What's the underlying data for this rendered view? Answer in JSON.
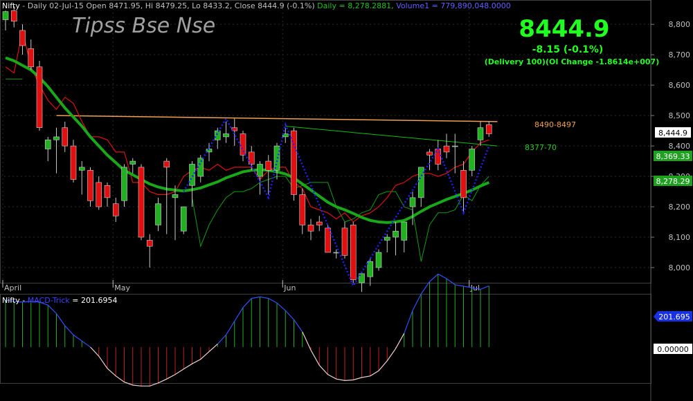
{
  "header": {
    "symbol": "Nifty",
    "info": " - Daily 02-Jul-15 Open 8471.95, Hi 8479.25, Lo 8433.2, Close 8444.9 (-0.1%) ",
    "daily": "Daily = 8,278.2881, ",
    "volume": "Volume1 = 779,890,048.0000"
  },
  "watermark": "Tipss Bse Nse",
  "price_panel": {
    "big_price": "8444.9",
    "change": "-8.15 (-0.1%)",
    "delivery": "(Delivery 100)(OI Change -1.8614e+007)"
  },
  "annotations": {
    "resistance": "8490-8497",
    "support": "8377-70"
  },
  "badges": {
    "last": "8,444.9",
    "ma1": "8,369.33",
    "ma2": "8,278.29",
    "macd": "201.695",
    "zero": "0.00000"
  },
  "indicator": {
    "symbol": "Nifty",
    "name": "MACD-Trick",
    "value": " = 201.6954"
  },
  "chart_data": {
    "type": "candlestick",
    "ylim": [
      7950,
      8880
    ],
    "y_ticks": [
      {
        "v": 8800,
        "label": "8,800"
      },
      {
        "v": 8700,
        "label": "8,700"
      },
      {
        "v": 8600,
        "label": "8,600"
      },
      {
        "v": 8500,
        "label": "8,500"
      },
      {
        "v": 8400,
        "label": "8,400"
      },
      {
        "v": 8300,
        "label": "8,300"
      },
      {
        "v": 8200,
        "label": "8,200"
      },
      {
        "v": 8100,
        "label": "8,100"
      },
      {
        "v": 8000,
        "label": "8,000"
      }
    ],
    "x_labels": [
      {
        "i": 0,
        "label": "April"
      },
      {
        "i": 13,
        "label": "May"
      },
      {
        "i": 33,
        "label": "Jun"
      },
      {
        "i": 55,
        "label": "Jul"
      }
    ],
    "colors": {
      "up": "#20b020",
      "down": "#e01010",
      "ma_thick": "#18a818",
      "ma_red": "#e01010",
      "ma_thin": "#10a010",
      "zigzag": "#2020ff",
      "resistance": "#f0a050",
      "support": "#10c010",
      "price_green": "#20ff20"
    },
    "candles": [
      [
        8815,
        8845,
        8780,
        8842
      ],
      [
        8845,
        8860,
        8790,
        8810
      ],
      [
        8780,
        8800,
        8700,
        8730
      ],
      [
        8720,
        8750,
        8650,
        8660
      ],
      [
        8660,
        8680,
        8450,
        8460
      ],
      [
        8390,
        8430,
        8350,
        8420
      ],
      [
        8420,
        8460,
        8310,
        8430
      ],
      [
        8460,
        8480,
        8380,
        8400
      ],
      [
        8400,
        8420,
        8280,
        8290
      ],
      [
        8320,
        8350,
        8240,
        8330
      ],
      [
        8320,
        8330,
        8200,
        8220
      ],
      [
        8280,
        8300,
        8190,
        8200
      ],
      [
        8270,
        8280,
        8200,
        8230
      ],
      [
        8210,
        8230,
        8150,
        8170
      ],
      [
        8220,
        8340,
        8200,
        8330
      ],
      [
        8340,
        8360,
        8310,
        8350
      ],
      [
        8330,
        8340,
        8090,
        8100
      ],
      [
        8090,
        8110,
        8000,
        8070
      ],
      [
        8140,
        8230,
        8120,
        8210
      ],
      [
        8350,
        8360,
        8110,
        8330
      ],
      [
        8230,
        8270,
        8090,
        8240
      ],
      [
        8120,
        8200,
        8110,
        8200
      ],
      [
        8270,
        8350,
        8200,
        8340
      ],
      [
        8300,
        8370,
        8280,
        8360
      ],
      [
        8380,
        8410,
        8350,
        8390
      ],
      [
        8420,
        8460,
        8390,
        8450
      ],
      [
        8430,
        8480,
        8410,
        8440
      ],
      [
        8460,
        8490,
        8400,
        8450
      ],
      [
        8440,
        8450,
        8350,
        8370
      ],
      [
        8380,
        8400,
        8320,
        8340
      ],
      [
        8300,
        8350,
        8240,
        8340
      ],
      [
        8350,
        8370,
        8240,
        8320
      ],
      [
        8320,
        8410,
        8290,
        8400
      ],
      [
        8430,
        8460,
        8410,
        8440
      ],
      [
        8450,
        8460,
        8220,
        8240
      ],
      [
        8240,
        8260,
        8110,
        8140
      ],
      [
        8140,
        8160,
        8090,
        8120
      ],
      [
        8150,
        8170,
        8120,
        8140
      ],
      [
        8130,
        8140,
        8050,
        8050
      ],
      [
        8050,
        8060,
        8030,
        8050
      ],
      [
        8130,
        8150,
        8030,
        8040
      ],
      [
        8140,
        8150,
        7950,
        7960
      ],
      [
        7950,
        7980,
        7920,
        7980
      ],
      [
        7970,
        8030,
        7940,
        8020
      ],
      [
        8000,
        8060,
        7990,
        8050
      ],
      [
        8090,
        8110,
        8050,
        8100
      ],
      [
        8100,
        8150,
        8040,
        8120
      ],
      [
        8090,
        8150,
        8050,
        8150
      ],
      [
        8200,
        8250,
        8140,
        8230
      ],
      [
        8230,
        8330,
        8200,
        8330
      ],
      [
        8380,
        8390,
        8320,
        8370
      ],
      [
        8390,
        8420,
        8320,
        8340
      ],
      [
        8400,
        8440,
        8360,
        8380
      ],
      [
        8400,
        8440,
        8310,
        8400
      ],
      [
        8320,
        8350,
        8180,
        8230
      ],
      [
        8320,
        8400,
        8300,
        8390
      ],
      [
        8420,
        8480,
        8400,
        8460
      ],
      [
        8470,
        8480,
        8430,
        8440
      ]
    ],
    "ma_thick": [
      8690,
      8680,
      8665,
      8650,
      8625,
      8595,
      8560,
      8525,
      8495,
      8465,
      8430,
      8400,
      8370,
      8345,
      8320,
      8305,
      8290,
      8275,
      8265,
      8258,
      8255,
      8252,
      8256,
      8262,
      8272,
      8282,
      8295,
      8305,
      8315,
      8320,
      8322,
      8320,
      8315,
      8308,
      8295,
      8275,
      8255,
      8235,
      8215,
      8200,
      8190,
      8178,
      8165,
      8155,
      8150,
      8148,
      8150,
      8155,
      8168,
      8185,
      8200,
      8212,
      8224,
      8234,
      8244,
      8255,
      8268,
      8280
    ],
    "ma_red": [
      8660,
      8640,
      8780,
      8660,
      8600,
      8550,
      8520,
      8560,
      8540,
      8480,
      8430,
      8430,
      8420,
      8380,
      8380,
      8280,
      8280,
      8250,
      8240,
      8240,
      8250,
      8300,
      8320,
      8330,
      8320,
      8340,
      8320,
      8330,
      8330,
      8330,
      8290,
      8320,
      8330,
      8330,
      8280,
      8260,
      8200,
      8190,
      8180,
      8160,
      8180,
      8150,
      8170,
      8180,
      8200,
      8230,
      8270,
      8280,
      8300,
      8310,
      8310,
      8300,
      8310,
      8330,
      8340,
      8380,
      8410,
      8420
    ],
    "ma_thin": [
      8620,
      8620,
      8620,
      null,
      null,
      null,
      null,
      null,
      null,
      null,
      null,
      null,
      null,
      null,
      null,
      null,
      null,
      null,
      null,
      null,
      null,
      null,
      8230,
      8070,
      8140,
      8190,
      8230,
      8250,
      8250,
      8260,
      8280,
      8290,
      8300,
      8300,
      8260,
      8270,
      8280,
      8280,
      8280,
      8200,
      8150,
      8160,
      8180,
      8190,
      8240,
      8250,
      8250,
      8200,
      8190,
      8020,
      8140,
      8180,
      8180,
      8190,
      8240,
      8220,
      8270,
      8300
    ],
    "zigzag": [
      [
        21,
        8250
      ],
      [
        26,
        8490
      ],
      [
        31,
        8230
      ],
      [
        33,
        8470
      ],
      [
        41,
        7940
      ],
      [
        51,
        8390
      ],
      [
        54,
        8180
      ],
      [
        57,
        8400
      ]
    ],
    "resistance": [
      [
        6,
        8500
      ],
      [
        58,
        8480
      ]
    ],
    "support": [
      [
        33,
        8465
      ],
      [
        58,
        8400
      ]
    ],
    "macd": [
      155,
      150,
      148,
      150,
      148,
      138,
      110,
      70,
      40,
      20,
      0,
      -30,
      -70,
      -95,
      -115,
      -125,
      -128,
      -128,
      -118,
      -105,
      -90,
      -72,
      -55,
      -40,
      -15,
      10,
      40,
      85,
      130,
      160,
      165,
      160,
      145,
      120,
      90,
      50,
      -10,
      -60,
      -90,
      -105,
      -110,
      -108,
      -100,
      -95,
      -78,
      -45,
      -5,
      45,
      120,
      175,
      215,
      240,
      225,
      205,
      200,
      195,
      190,
      201
    ]
  }
}
